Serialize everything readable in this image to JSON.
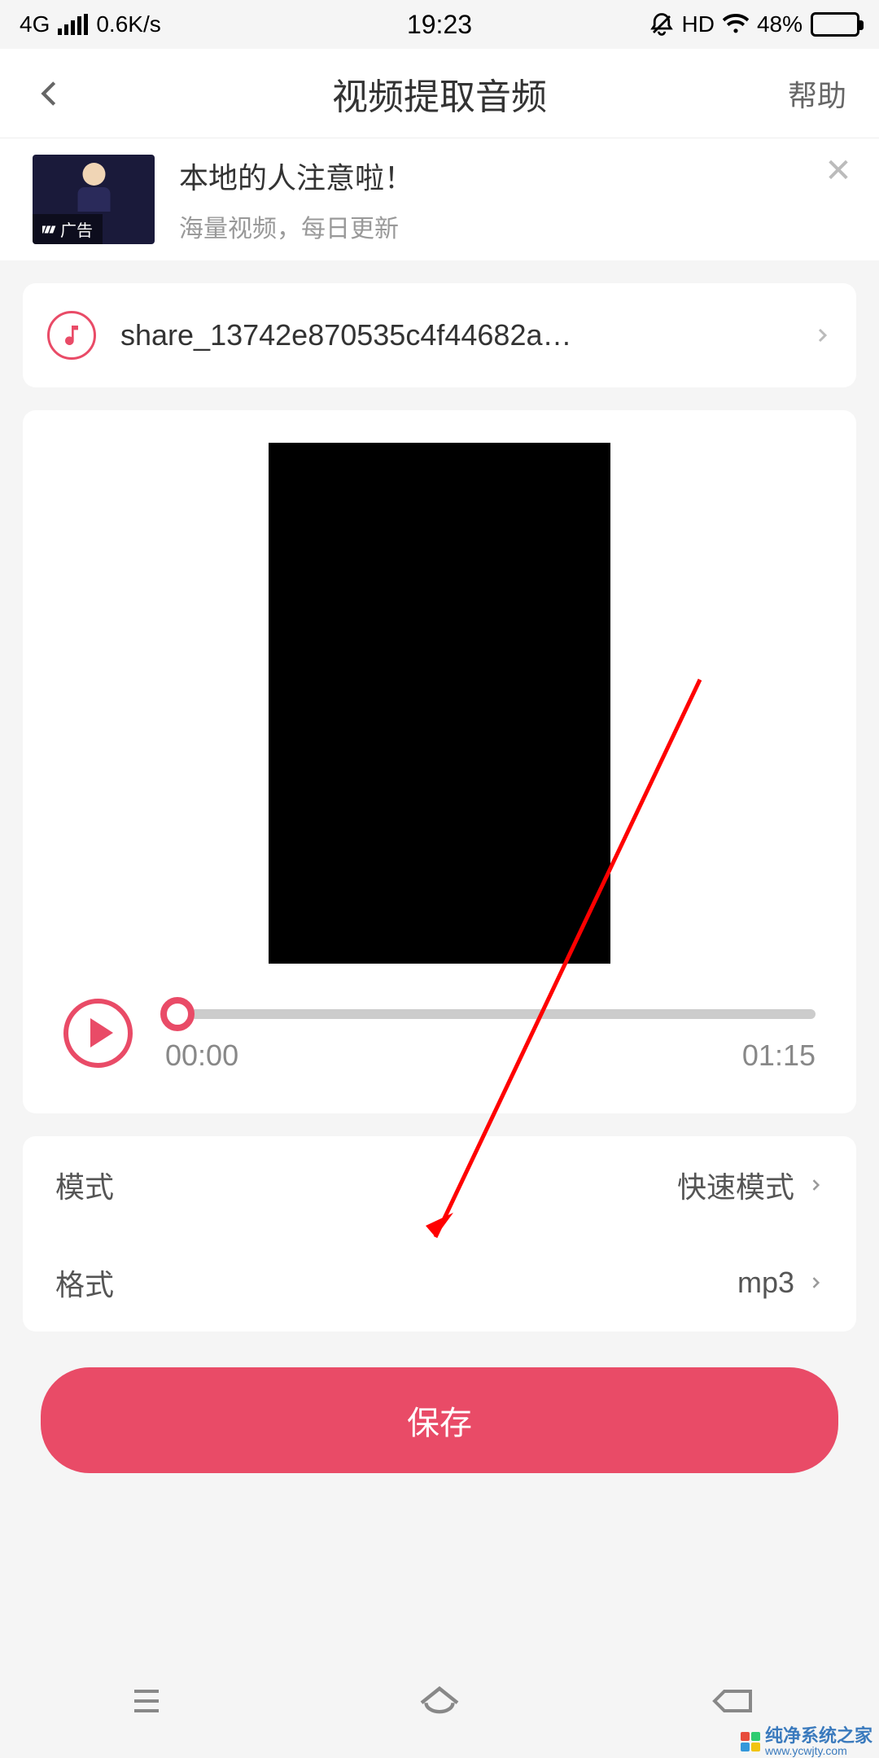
{
  "status": {
    "network": "4G",
    "speed": "0.6K/s",
    "time": "19:23",
    "hd": "HD",
    "battery_pct": "48%"
  },
  "header": {
    "title": "视频提取音频",
    "help": "帮助"
  },
  "ad": {
    "title": "本地的人注意啦！",
    "subtitle": "海量视频，每日更新",
    "badge": "广告"
  },
  "file": {
    "name": "share_13742e870535c4f44682a…"
  },
  "player": {
    "current": "00:00",
    "duration": "01:15"
  },
  "settings": {
    "mode_label": "模式",
    "mode_value": "快速模式",
    "format_label": "格式",
    "format_value": "mp3"
  },
  "actions": {
    "save": "保存"
  },
  "watermark": {
    "text": "纯净系统之家",
    "url": "www.ycwjty.com"
  }
}
